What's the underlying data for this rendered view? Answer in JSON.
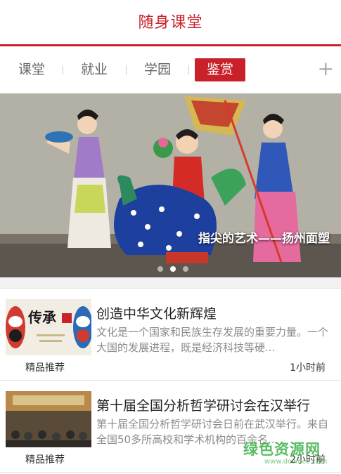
{
  "header": {
    "title": "随身课堂"
  },
  "tabs": [
    {
      "label": "课堂",
      "active": false
    },
    {
      "label": "就业",
      "active": false
    },
    {
      "label": "学园",
      "active": false
    },
    {
      "label": "鉴赏",
      "active": true
    }
  ],
  "add_tab_symbol": "+",
  "banner": {
    "caption": "指尖的艺术——扬州面塑",
    "slide_count": 3,
    "active_slide": 1
  },
  "articles": [
    {
      "title": "创造中华文化新辉煌",
      "summary": "文化是一个国家和民族生存发展的重要力量。一个大国的发展进程，既是经济科技等硬...",
      "tag": "精品推荐",
      "time": "1小时前",
      "thumb_text": "传承"
    },
    {
      "title": "第十届全国分析哲学研讨会在汉举行",
      "summary": "第十届全国分析哲学研讨会日前在武汉举行。来自全国50多所高校和学术机构的百余名...",
      "tag": "精品推荐",
      "time": "2小时前"
    }
  ],
  "watermark": {
    "main": "绿色资源网",
    "sub": "www.downcc.com"
  },
  "colors": {
    "accent": "#c9212a",
    "watermark": "#3db14a"
  }
}
